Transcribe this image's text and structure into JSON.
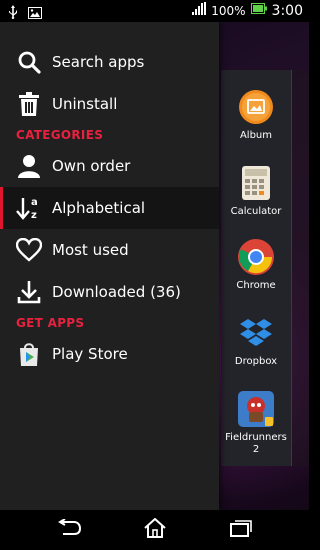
{
  "status_bar": {
    "battery_percent": "100%",
    "time": "3:00",
    "icons": [
      "usb-icon",
      "image-icon",
      "signal-icon",
      "battery-icon"
    ]
  },
  "drawer": {
    "items": [
      {
        "label": "Search apps",
        "icon": "search-icon"
      },
      {
        "label": "Uninstall",
        "icon": "trash-icon"
      },
      {
        "label": "Own order",
        "icon": "person-icon"
      },
      {
        "label": "Alphabetical",
        "icon": "sort-alpha-icon",
        "active": true
      },
      {
        "label": "Most used",
        "icon": "heart-icon"
      },
      {
        "label": "Downloaded (36)",
        "icon": "download-icon"
      },
      {
        "label": "Play Store",
        "icon": "play-store-icon"
      }
    ],
    "sections": {
      "categories": "CATEGORIES",
      "get_apps": "GET APPS"
    }
  },
  "apps": [
    {
      "label": "Album",
      "icon": "album-icon"
    },
    {
      "label": "Calculator",
      "icon": "calculator-icon"
    },
    {
      "label": "Chrome",
      "icon": "chrome-icon"
    },
    {
      "label": "Dropbox",
      "icon": "dropbox-icon"
    },
    {
      "label": "Fieldrunners 2",
      "icon": "fieldrunners-icon"
    }
  ],
  "nav_bar": {
    "buttons": [
      "back-icon",
      "home-icon",
      "recent-apps-icon"
    ]
  },
  "colors": {
    "accent": "#e8213f",
    "drawer_bg": "#202020",
    "active_bg": "#141414"
  }
}
